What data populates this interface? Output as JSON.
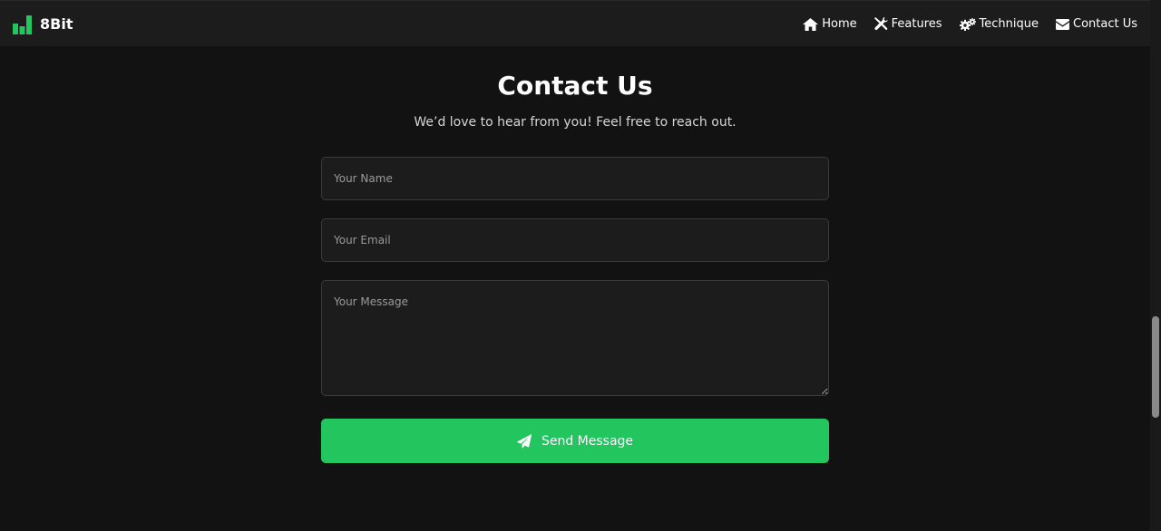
{
  "brand": {
    "name": "8Bit",
    "icon": "bar-chart-icon",
    "color": "#22c55e"
  },
  "nav": {
    "items": [
      {
        "label": "Home",
        "icon": "home-icon"
      },
      {
        "label": "Features",
        "icon": "tools-icon"
      },
      {
        "label": "Technique",
        "icon": "gears-icon"
      },
      {
        "label": "Contact Us",
        "icon": "envelope-icon"
      }
    ]
  },
  "contact": {
    "title": "Contact Us",
    "subtitle": "We’d love to hear from you! Feel free to reach out.",
    "name_placeholder": "Your Name",
    "email_placeholder": "Your Email",
    "message_placeholder": "Your Message",
    "send_label": "Send Message",
    "send_icon": "paper-plane-icon"
  },
  "colors": {
    "background": "#121212",
    "navbar": "#1c1c1c",
    "accent": "#22c55e",
    "field_background": "#1c1c1c",
    "field_border": "#3a3a3a"
  }
}
